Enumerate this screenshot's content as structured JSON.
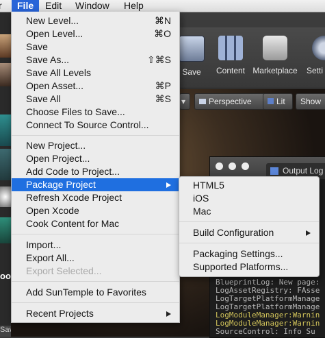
{
  "menubar": {
    "partial_left": "r",
    "items": [
      "File",
      "Edit",
      "Window",
      "Help"
    ]
  },
  "file_menu": {
    "items": [
      {
        "label": "New Level...",
        "shortcut": "⌘N"
      },
      {
        "label": "Open Level...",
        "shortcut": "⌘O"
      },
      {
        "label": "Save",
        "shortcut": ""
      },
      {
        "label": "Save As...",
        "shortcut": "⇧⌘S"
      },
      {
        "label": "Save All Levels",
        "shortcut": ""
      },
      {
        "label": "Open Asset...",
        "shortcut": "⌘P"
      },
      {
        "label": "Save All",
        "shortcut": "⌘S"
      },
      {
        "label": "Choose Files to Save...",
        "shortcut": ""
      },
      {
        "label": "Connect To Source Control...",
        "shortcut": ""
      },
      {
        "label": "New Project...",
        "shortcut": ""
      },
      {
        "label": "Open Project...",
        "shortcut": ""
      },
      {
        "label": "Add Code to Project...",
        "shortcut": ""
      },
      {
        "label": "Package Project",
        "shortcut": ""
      },
      {
        "label": "Refresh Xcode Project",
        "shortcut": ""
      },
      {
        "label": "Open Xcode",
        "shortcut": ""
      },
      {
        "label": "Cook Content for Mac",
        "shortcut": ""
      },
      {
        "label": "Import...",
        "shortcut": ""
      },
      {
        "label": "Export All...",
        "shortcut": ""
      },
      {
        "label": "Export Selected...",
        "shortcut": ""
      },
      {
        "label": "Add SunTemple to Favorites",
        "shortcut": ""
      },
      {
        "label": "Recent Projects",
        "shortcut": ""
      }
    ],
    "highlighted": "Package Project"
  },
  "package_submenu": {
    "items": [
      "HTML5",
      "iOS",
      "Mac",
      "Build Configuration",
      "Packaging Settings...",
      "Supported Platforms..."
    ]
  },
  "toolbar": {
    "save_label": "Save",
    "content_label": "Content",
    "marketplace_label": "Marketplace",
    "settings_partial": "Setti"
  },
  "viewport": {
    "perspective_label": "Perspective",
    "lit_label": "Lit",
    "show_label": "Show"
  },
  "output_log": {
    "tab_label": "Output Log",
    "lines": [
      {
        "text": "BlueprintLog: New page:",
        "color": "#b9b9b9"
      },
      {
        "text": "LogAssetRegistry: FAsse",
        "color": "#b9b9b9"
      },
      {
        "text": "LogTargetPlatformManage",
        "color": "#b9b9b9"
      },
      {
        "text": "LogTargetPlatformManage",
        "color": "#b9b9b9"
      },
      {
        "text": "LogModuleManager:Warnin",
        "color": "#d2c45a"
      },
      {
        "text": "LogModuleManager:Warnin",
        "color": "#d2c45a"
      },
      {
        "text": "SourceControl: Info Su",
        "color": "#b9b9b9"
      }
    ]
  },
  "left_panel": {
    "partial_labels": [
      "oon",
      "Sav"
    ]
  },
  "colors": {
    "menu_highlight": "#1f6fe0",
    "menubar_active": "#2864d8"
  }
}
